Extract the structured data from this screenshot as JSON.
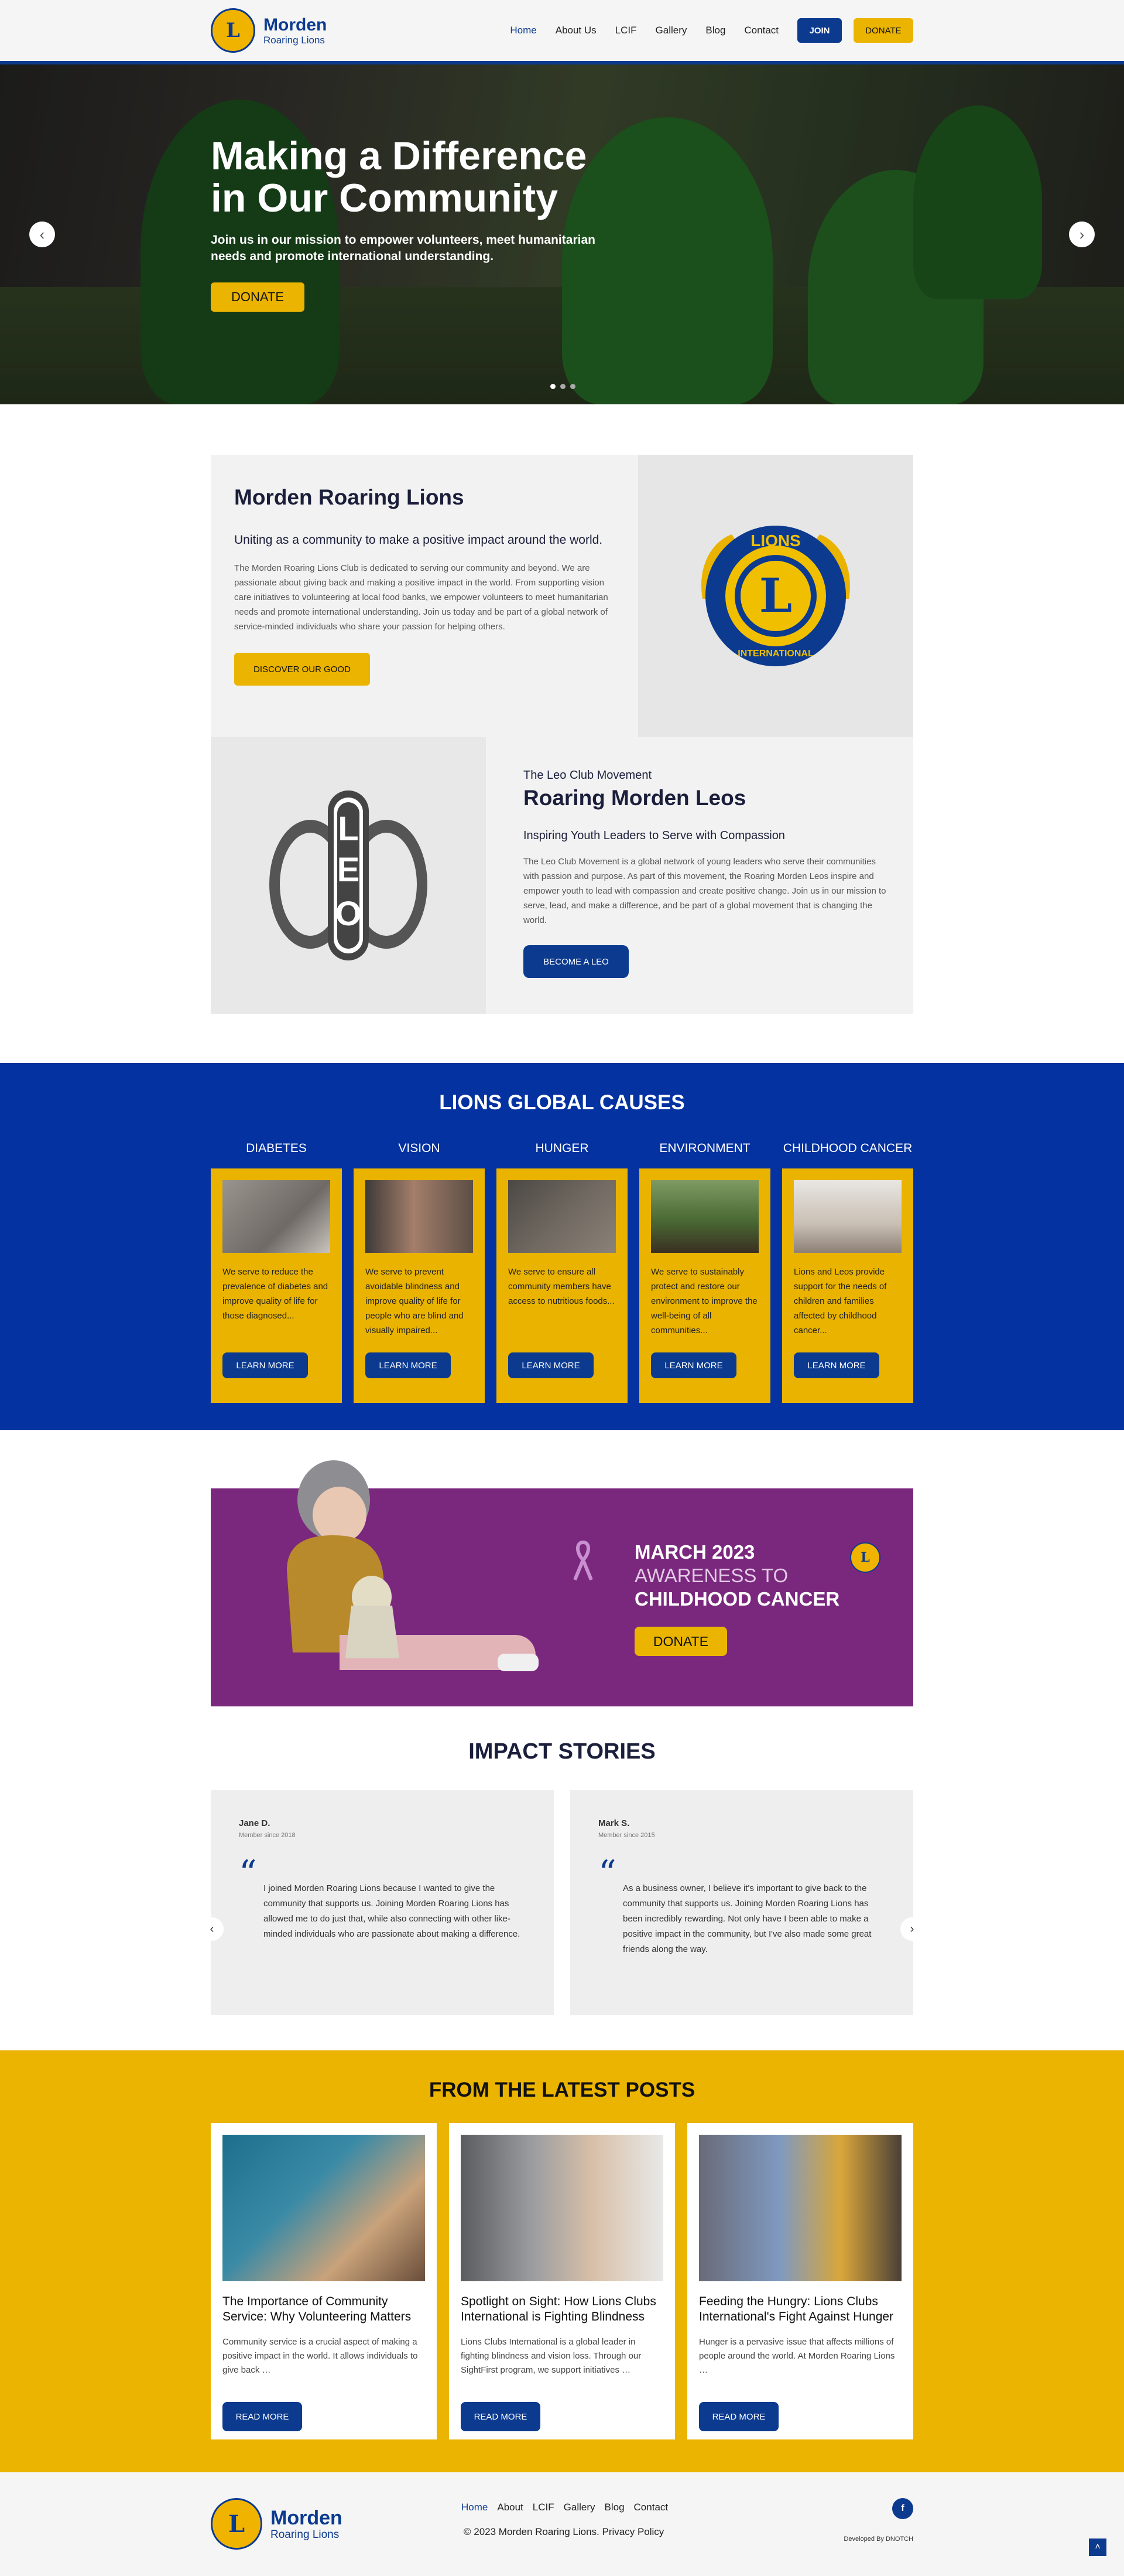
{
  "site": {
    "name_line1": "Morden",
    "name_line2": "Roaring Lions",
    "logo_text": "L"
  },
  "nav": [
    {
      "label": "Home"
    },
    {
      "label": "About Us"
    },
    {
      "label": "LCIF"
    },
    {
      "label": "Gallery"
    },
    {
      "label": "Blog"
    },
    {
      "label": "Contact"
    }
  ],
  "header_buttons": {
    "join": "JOIN",
    "donate": "DONATE"
  },
  "hero": {
    "title_line1": "Making a Difference",
    "title_line2": "in Our Community",
    "subtitle": "Join us in our mission to empower volunteers, meet humanitarian needs and promote international understanding.",
    "button": "DONATE",
    "prev": "‹",
    "next": "›"
  },
  "about": {
    "title": "Morden Roaring Lions",
    "subtitle": "Uniting as a community to make a positive impact around the world.",
    "body": "The Morden Roaring Lions Club is dedicated to serving our community and beyond. We are passionate about giving back and making a positive impact in the world. From supporting vision care initiatives to volunteering at local food banks, we empower volunteers to meet humanitarian needs and promote international understanding. Join us today and be part of a global network of service-minded individuals who share your passion for helping others.",
    "button": "DISCOVER OUR GOOD",
    "logo_top": "LIONS",
    "logo_bottom": "INTERNATIONAL",
    "logo_letter": "L"
  },
  "leo": {
    "eyebrow": "The Leo Club Movement",
    "title": "Roaring Morden Leos",
    "subtitle": "Inspiring Youth Leaders to Serve with Compassion",
    "body": "The Leo Club Movement is a global network of young leaders who serve their communities with passion and purpose. As part of this movement, the Roaring Morden Leos inspire and empower youth to lead with compassion and create positive change. Join us in our mission to serve, lead, and make a difference, and be part of a global movement that is changing the world.",
    "button": "BECOME A LEO",
    "logo_letters": [
      "L",
      "E",
      "O"
    ]
  },
  "causes": {
    "title": "LIONS GLOBAL CAUSES",
    "items": [
      {
        "name": "DIABETES",
        "text": "We serve to reduce the prevalence of diabetes and improve quality of life for those diagnosed...",
        "button": "LEARN MORE",
        "img_color": "#8a8580"
      },
      {
        "name": "VISION",
        "text": "We serve to prevent avoidable blindness and improve quality of life for people who are blind and visually impaired...",
        "button": "LEARN MORE",
        "img_color": "#6a6460"
      },
      {
        "name": "HUNGER",
        "text": "We serve to ensure all community members have access to nutritious foods...",
        "button": "LEARN MORE",
        "img_color": "#5b5550"
      },
      {
        "name": "ENVIRONMENT",
        "text": "We serve to sustainably protect and restore our environment to improve the well-being of all communities...",
        "button": "LEARN MORE",
        "img_color": "#4a6a3a"
      },
      {
        "name": "CHILDHOOD CANCER",
        "text": "Lions and Leos provide support for the needs of children and families affected by childhood cancer...",
        "button": "LEARN MORE",
        "img_color": "#b8b4ae"
      }
    ]
  },
  "banner": {
    "line1": "MARCH 2023",
    "line2": "AWARENESS TO",
    "line3": "CHILDHOOD CANCER",
    "button": "DONATE"
  },
  "stories": {
    "title": "IMPACT STORIES",
    "prev": "‹",
    "next": "›",
    "items": [
      {
        "name": "Jane D.",
        "since": "Member since 2018",
        "quote": "I joined Morden Roaring Lions because I wanted to give the community that supports us. Joining Morden Roaring Lions has allowed me to do just that, while also connecting with other like-minded individuals who are passionate about making a difference."
      },
      {
        "name": "Mark S.",
        "since": "Member since 2015",
        "quote": "As a business owner, I believe it's important to give back to the community that supports us. Joining Morden Roaring Lions has been incredibly rewarding. Not only have I been able to make a positive impact in the community, but I've also made some great friends along the way."
      }
    ]
  },
  "posts": {
    "title": "FROM THE LATEST POSTS",
    "items": [
      {
        "title": "The Importance of Community Service: Why Volunteering Matters",
        "excerpt": "Community service is a crucial aspect of making a positive impact in the world. It allows individuals to give back …",
        "button": "READ MORE"
      },
      {
        "title": "Spotlight on Sight: How Lions Clubs International is Fighting Blindness",
        "excerpt": "Lions Clubs International is a global leader in fighting blindness and vision loss. Through our SightFirst program, we support initiatives …",
        "button": "READ MORE"
      },
      {
        "title": "Feeding the Hungry: Lions Clubs International's Fight Against Hunger",
        "excerpt": "Hunger is a pervasive issue that affects millions of people around the world. At Morden Roaring Lions …",
        "button": "READ MORE"
      }
    ]
  },
  "footer": {
    "nav": [
      {
        "label": "Home"
      },
      {
        "label": "About"
      },
      {
        "label": "LCIF"
      },
      {
        "label": "Gallery"
      },
      {
        "label": "Blog"
      },
      {
        "label": "Contact"
      }
    ],
    "copyright": "© 2023 Morden Roaring Lions. Privacy Policy",
    "developer": "Developed By DNOTCH",
    "facebook": "f",
    "to_top": "˄"
  }
}
